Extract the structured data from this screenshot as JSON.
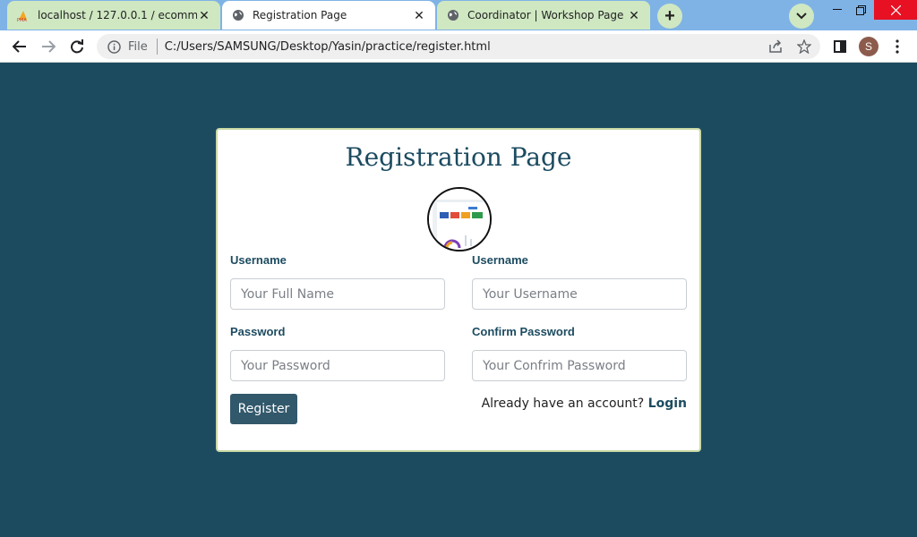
{
  "browser": {
    "tabs": [
      {
        "title": "localhost / 127.0.0.1 / ecommerce",
        "icon": "phpmyadmin-icon",
        "active": false
      },
      {
        "title": "Registration Page",
        "icon": "globe-icon",
        "active": true
      },
      {
        "title": "Coordinator | Workshop Page",
        "icon": "globe-icon",
        "active": false
      }
    ],
    "newtab_label": "+",
    "site_chip": "File",
    "url": "C:/Users/SAMSUNG/Desktop/Yasin/practice/register.html",
    "avatar_letter": "S",
    "colors": {
      "tabstrip": "#7fb3e6",
      "inactive_tab": "#cfe8c2",
      "close": "#e81123"
    }
  },
  "page": {
    "title": "Registration Page",
    "fields": {
      "fullname": {
        "label": "Username",
        "placeholder": "Your Full Name"
      },
      "username": {
        "label": "Username",
        "placeholder": "Your Username"
      },
      "password": {
        "label": "Password",
        "placeholder": "Your Password"
      },
      "confirm": {
        "label": "Confirm Password",
        "placeholder": "Your Confrim Password"
      }
    },
    "register_label": "Register",
    "already_text": "Already have an account?",
    "login_label": "Login",
    "colors": {
      "background": "#1c4b60",
      "button": "#32586b",
      "card_border": "#c9d9a4"
    }
  }
}
